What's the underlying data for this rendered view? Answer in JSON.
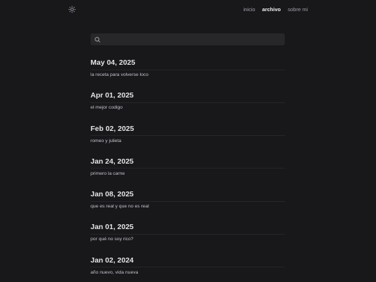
{
  "header": {
    "theme_toggle_icon": "sun-icon",
    "nav": [
      {
        "label": "inicio",
        "active": false
      },
      {
        "label": "archivo",
        "active": true
      },
      {
        "label": "sobre mi",
        "active": false
      }
    ]
  },
  "search": {
    "placeholder": "",
    "value": "",
    "icon": "search-icon"
  },
  "archive": {
    "entries": [
      {
        "date": "May 04, 2025",
        "title": "la receta para volverse loco"
      },
      {
        "date": "Apr 01, 2025",
        "title": "el mejor codigo"
      },
      {
        "date": "Feb 02, 2025",
        "title": "romeo y julieta"
      },
      {
        "date": "Jan 24, 2025",
        "title": "primero la carne"
      },
      {
        "date": "Jan 08, 2025",
        "title": "que es real y que no es real"
      },
      {
        "date": "Jan 01, 2025",
        "title": "por qué no soy rico?"
      },
      {
        "date": "Jan 02, 2024",
        "title": "año nuevo, vida nueva"
      }
    ]
  },
  "colors": {
    "background": "#18181b",
    "search_bg": "#27272a",
    "text_primary": "#e4e4e7",
    "text_muted": "#a1a1aa"
  }
}
